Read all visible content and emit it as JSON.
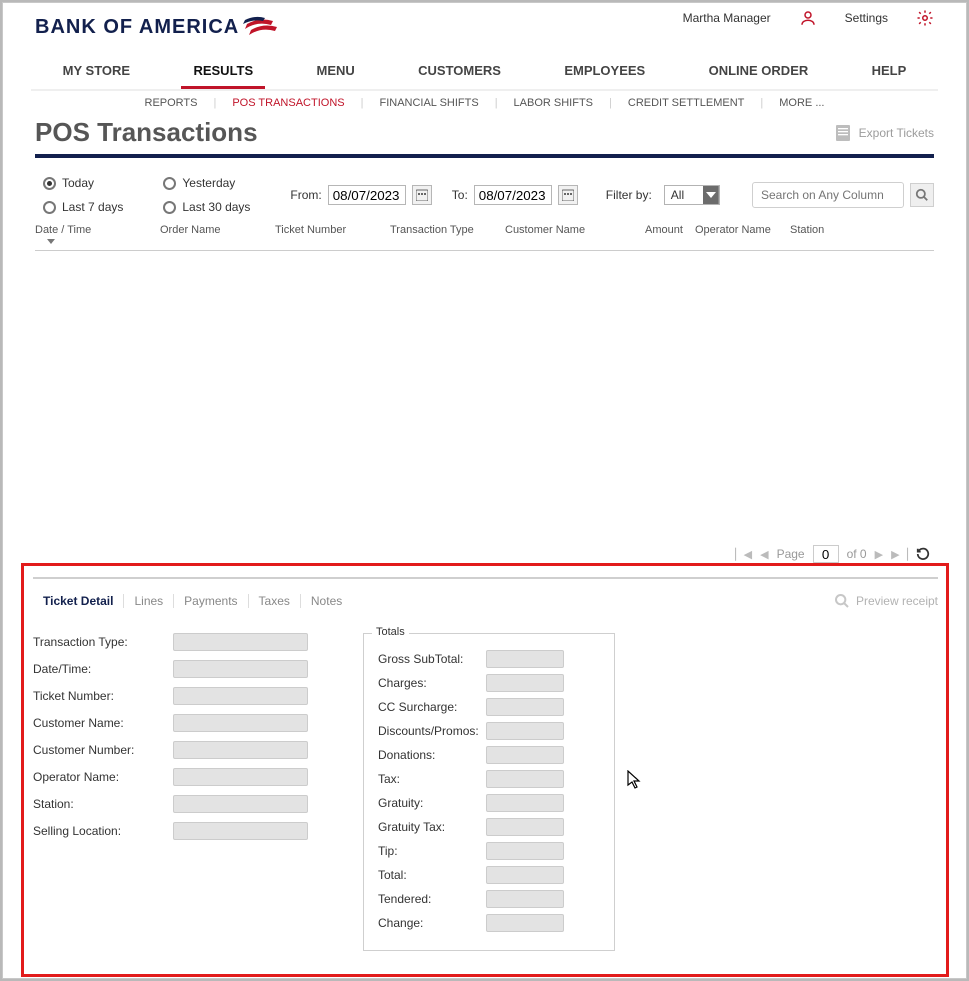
{
  "brand": "BANK OF AMERICA",
  "topbar": {
    "user": "Martha Manager",
    "settings": "Settings"
  },
  "nav_primary": [
    "MY STORE",
    "RESULTS",
    "MENU",
    "CUSTOMERS",
    "EMPLOYEES",
    "ONLINE ORDER",
    "HELP"
  ],
  "nav_primary_active": 1,
  "nav_secondary": [
    "REPORTS",
    "POS TRANSACTIONS",
    "FINANCIAL SHIFTS",
    "LABOR SHIFTS",
    "CREDIT SETTLEMENT",
    "MORE ..."
  ],
  "nav_secondary_active": 1,
  "page_title": "POS Transactions",
  "export_label": "Export Tickets",
  "radios": {
    "today": "Today",
    "yesterday": "Yesterday",
    "last7": "Last 7 days",
    "last30": "Last 30 days"
  },
  "from_label": "From:",
  "to_label": "To:",
  "from_date": "08/07/2023",
  "to_date": "08/07/2023",
  "filter_by_label": "Filter by:",
  "filter_value": "All",
  "search_placeholder": "Search on Any Column",
  "columns": [
    "Date / Time",
    "Order Name",
    "Ticket Number",
    "Transaction Type",
    "Customer Name",
    "Amount",
    "Operator Name",
    "Station"
  ],
  "pager": {
    "page_label": "Page",
    "page_value": "0",
    "of_label": "of 0"
  },
  "detail_tabs": [
    "Ticket Detail",
    "Lines",
    "Payments",
    "Taxes",
    "Notes"
  ],
  "detail_tabs_active": 0,
  "preview_label": "Preview receipt",
  "fields_left": [
    "Transaction Type:",
    "Date/Time:",
    "Ticket Number:",
    "Customer Name:",
    "Customer Number:",
    "Operator Name:",
    "Station:",
    "Selling Location:"
  ],
  "totals_title": "Totals",
  "totals_fields": [
    "Gross SubTotal:",
    "Charges:",
    "CC Surcharge:",
    "Discounts/Promos:",
    "Donations:",
    "Tax:",
    "Gratuity:",
    "Gratuity Tax:",
    "Tip:",
    "Total:",
    "Tendered:",
    "Change:"
  ]
}
